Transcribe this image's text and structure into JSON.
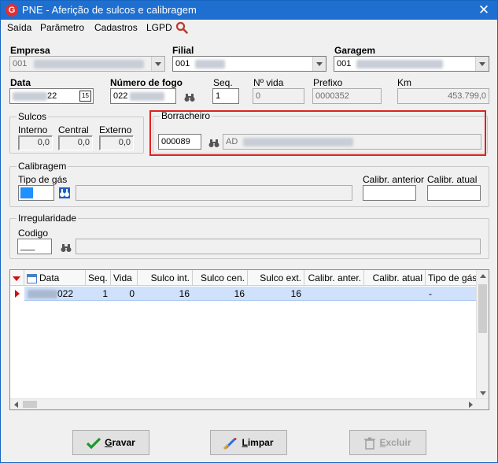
{
  "window": {
    "title": "PNE - Aferição de sulcos e calibragem",
    "close_glyph": "✕",
    "app_icon_letter": "G"
  },
  "menu": {
    "items": [
      "Saída",
      "Parâmetro",
      "Cadastros",
      "LGPD"
    ],
    "search_icon": "magnifier-icon"
  },
  "form": {
    "empresa_label": "Empresa",
    "empresa_value": "001",
    "filial_label": "Filial",
    "filial_value": "001",
    "garagem_label": "Garagem",
    "garagem_value": "001",
    "data_label": "Data",
    "data_value_suffix": "22",
    "calendar_glyph": "15",
    "numero_fogo_label": "Número de fogo",
    "numero_fogo_value": "022",
    "seq_label": "Seq.",
    "seq_value": "1",
    "nvida_label": "Nº vida",
    "nvida_value": "0",
    "prefixo_label": "Prefixo",
    "prefixo_value": "0000352",
    "km_label": "Km",
    "km_value": "453.799,0"
  },
  "sulcos": {
    "title": "Sulcos",
    "interno_label": "Interno",
    "interno_value": "0,0",
    "central_label": "Central",
    "central_value": "0,0",
    "externo_label": "Externo",
    "externo_value": "0,0"
  },
  "borracheiro": {
    "title": "Borracheiro",
    "code_value": "000089",
    "name_prefix": "AD"
  },
  "calibragem": {
    "title": "Calibragem",
    "tipo_gas_label": "Tipo de gás",
    "calibr_anterior_label": "Calibr. anterior",
    "calibr_atual_label": "Calibr. atual"
  },
  "irregularidade": {
    "title": "Irregularidade",
    "codigo_label": "Codigo",
    "codigo_value": "___"
  },
  "grid": {
    "headers": [
      "Data",
      "Seq.",
      "Vida",
      "Sulco int.",
      "Sulco cen.",
      "Sulco ext.",
      "Calibr. anter.",
      "Calibr. atual",
      "Tipo de gás"
    ],
    "rows": [
      {
        "data": "022",
        "seq": "1",
        "vida": "0",
        "sulco_int": "16",
        "sulco_cen": "16",
        "sulco_ext": "16",
        "calibr_anter": "",
        "calibr_atual": "",
        "tipo_gas": "-"
      }
    ]
  },
  "buttons": {
    "gravar_first": "G",
    "gravar_rest": "ravar",
    "limpar_first": "L",
    "limpar_rest": "impar",
    "excluir_first": "E",
    "excluir_rest": "xcluir"
  },
  "colors": {
    "titlebar": "#1e6fd0",
    "highlight_box": "#e02020",
    "selected_row": "#cfe1fb",
    "tipo_gas_swatch": "#1e90ff"
  }
}
